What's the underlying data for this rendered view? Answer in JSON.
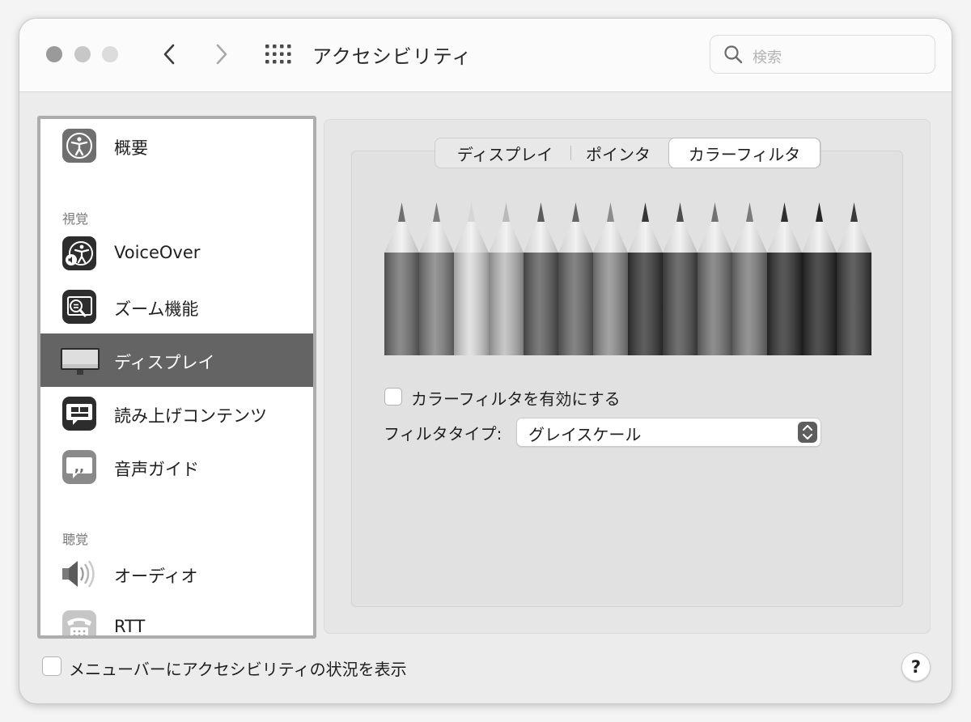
{
  "window": {
    "title": "アクセシビリティ",
    "search_placeholder": "検索"
  },
  "sidebar": {
    "items": [
      {
        "label": "概要",
        "icon": "accessibility-overview-icon"
      },
      {
        "label": "VoiceOver",
        "icon": "voiceover-icon"
      },
      {
        "label": "ズーム機能",
        "icon": "zoom-icon"
      },
      {
        "label": "ディスプレイ",
        "icon": "display-icon",
        "selected": true
      },
      {
        "label": "読み上げコンテンツ",
        "icon": "spoken-content-icon"
      },
      {
        "label": "音声ガイド",
        "icon": "descriptions-icon"
      },
      {
        "label": "オーディオ",
        "icon": "speaker-icon"
      },
      {
        "label": "RTT",
        "icon": "rtt-telephone-icon"
      }
    ],
    "sections": {
      "vision": "視覚",
      "hearing": "聴覚"
    }
  },
  "tabs": [
    {
      "label": "ディスプレイ",
      "active": false
    },
    {
      "label": "ポインタ",
      "active": false
    },
    {
      "label": "カラーフィルタ",
      "active": true
    }
  ],
  "color_filter": {
    "enable_label": "カラーフィルタを有効にする",
    "enabled": false,
    "filter_type_label": "フィルタタイプ:",
    "filter_type_value": "グレイスケール"
  },
  "footer": {
    "menubar_checkbox_label": "メニューバーにアクセシビリティの状況を表示",
    "menubar_checked": false,
    "help_label": "?"
  }
}
